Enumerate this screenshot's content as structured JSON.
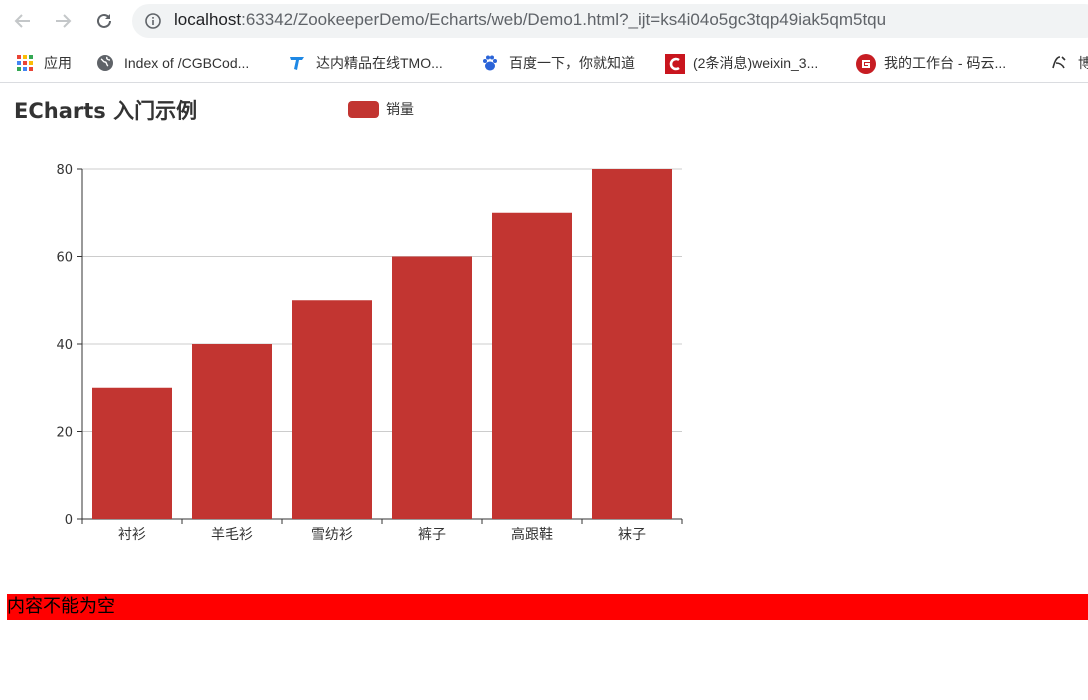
{
  "browser": {
    "url_host": "localhost",
    "url_rest": ":63342/ZookeeperDemo/Echarts/web/Demo1.html?_ijt=ks4i04o5gc3tqp49iak5qm5tqu",
    "bookmarks": [
      {
        "label": "应用",
        "icon": "apps-grid-icon"
      },
      {
        "label": "Index of /CGBCod...",
        "icon": "globe-icon"
      },
      {
        "label": "达内精品在线TMO...",
        "icon": "bookmark-t-icon"
      },
      {
        "label": "百度一下，你就知道",
        "icon": "baidu-paw-icon"
      },
      {
        "label": "(2条消息)weixin_3...",
        "icon": "csdn-c-icon"
      },
      {
        "label": "我的工作台 - 码云...",
        "icon": "gitee-icon"
      },
      {
        "label": "博",
        "icon": "bookmark-icon"
      }
    ]
  },
  "page": {
    "title": "ECharts 入门示例",
    "error_message": "内容不能为空"
  },
  "chart_data": {
    "type": "bar",
    "title": "ECharts 入门示例",
    "categories": [
      "衬衫",
      "羊毛衫",
      "雪纺衫",
      "裤子",
      "高跟鞋",
      "袜子"
    ],
    "series": [
      {
        "name": "销量",
        "values": [
          30,
          40,
          50,
          60,
          70,
          80
        ],
        "color": "#c23531"
      }
    ],
    "ylim": [
      0,
      80
    ],
    "yticks": [
      0,
      20,
      40,
      60,
      80
    ],
    "grid": true,
    "legend": "top-center"
  }
}
